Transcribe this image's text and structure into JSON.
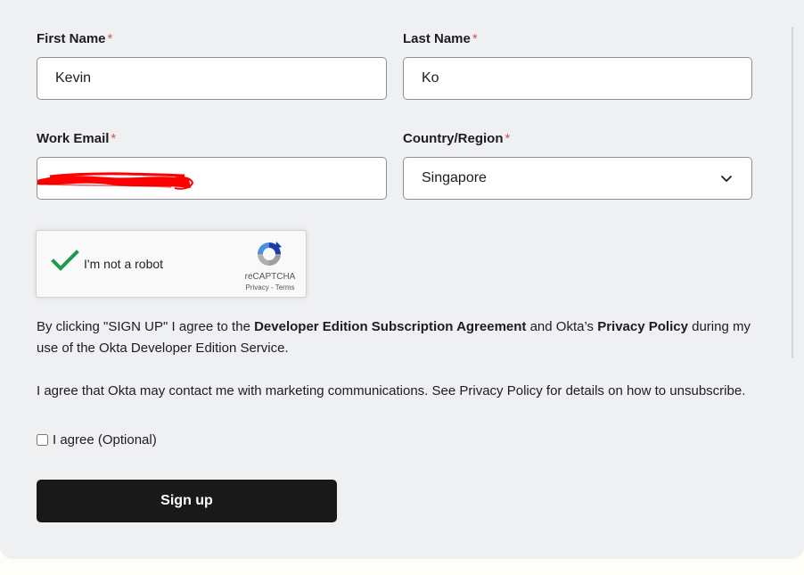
{
  "form": {
    "first_name": {
      "label": "First Name",
      "required_mark": "*",
      "value": "Kevin"
    },
    "last_name": {
      "label": "Last Name",
      "required_mark": "*",
      "value": "Ko"
    },
    "work_email": {
      "label": "Work Email",
      "required_mark": "*",
      "value": ""
    },
    "country": {
      "label": "Country/Region",
      "required_mark": "*",
      "selected": "Singapore"
    }
  },
  "recaptcha": {
    "checkbox_label": "I'm not a robot",
    "brand": "reCAPTCHA",
    "links": "Privacy - Terms",
    "checked": true
  },
  "agreement": {
    "prefix": "By clicking \"SIGN UP\" I agree to the ",
    "subscription_link": "Developer Edition Subscription Agreement",
    "middle": " and Okta’s ",
    "privacy_link": "Privacy Policy",
    "suffix": " during my use of the Okta Developer Edition Service."
  },
  "marketing": {
    "text": "I agree that Okta may contact me with marketing communications. See Privacy Policy for details on how to unsubscribe.",
    "checkbox_label": "I agree (Optional)",
    "checked": false
  },
  "submit": {
    "label": "Sign up"
  },
  "colors": {
    "panel": "#eff0f2",
    "required": "#d4554a",
    "button": "#191919",
    "redaction": "#ff0000",
    "check": "#1f9a4b"
  }
}
